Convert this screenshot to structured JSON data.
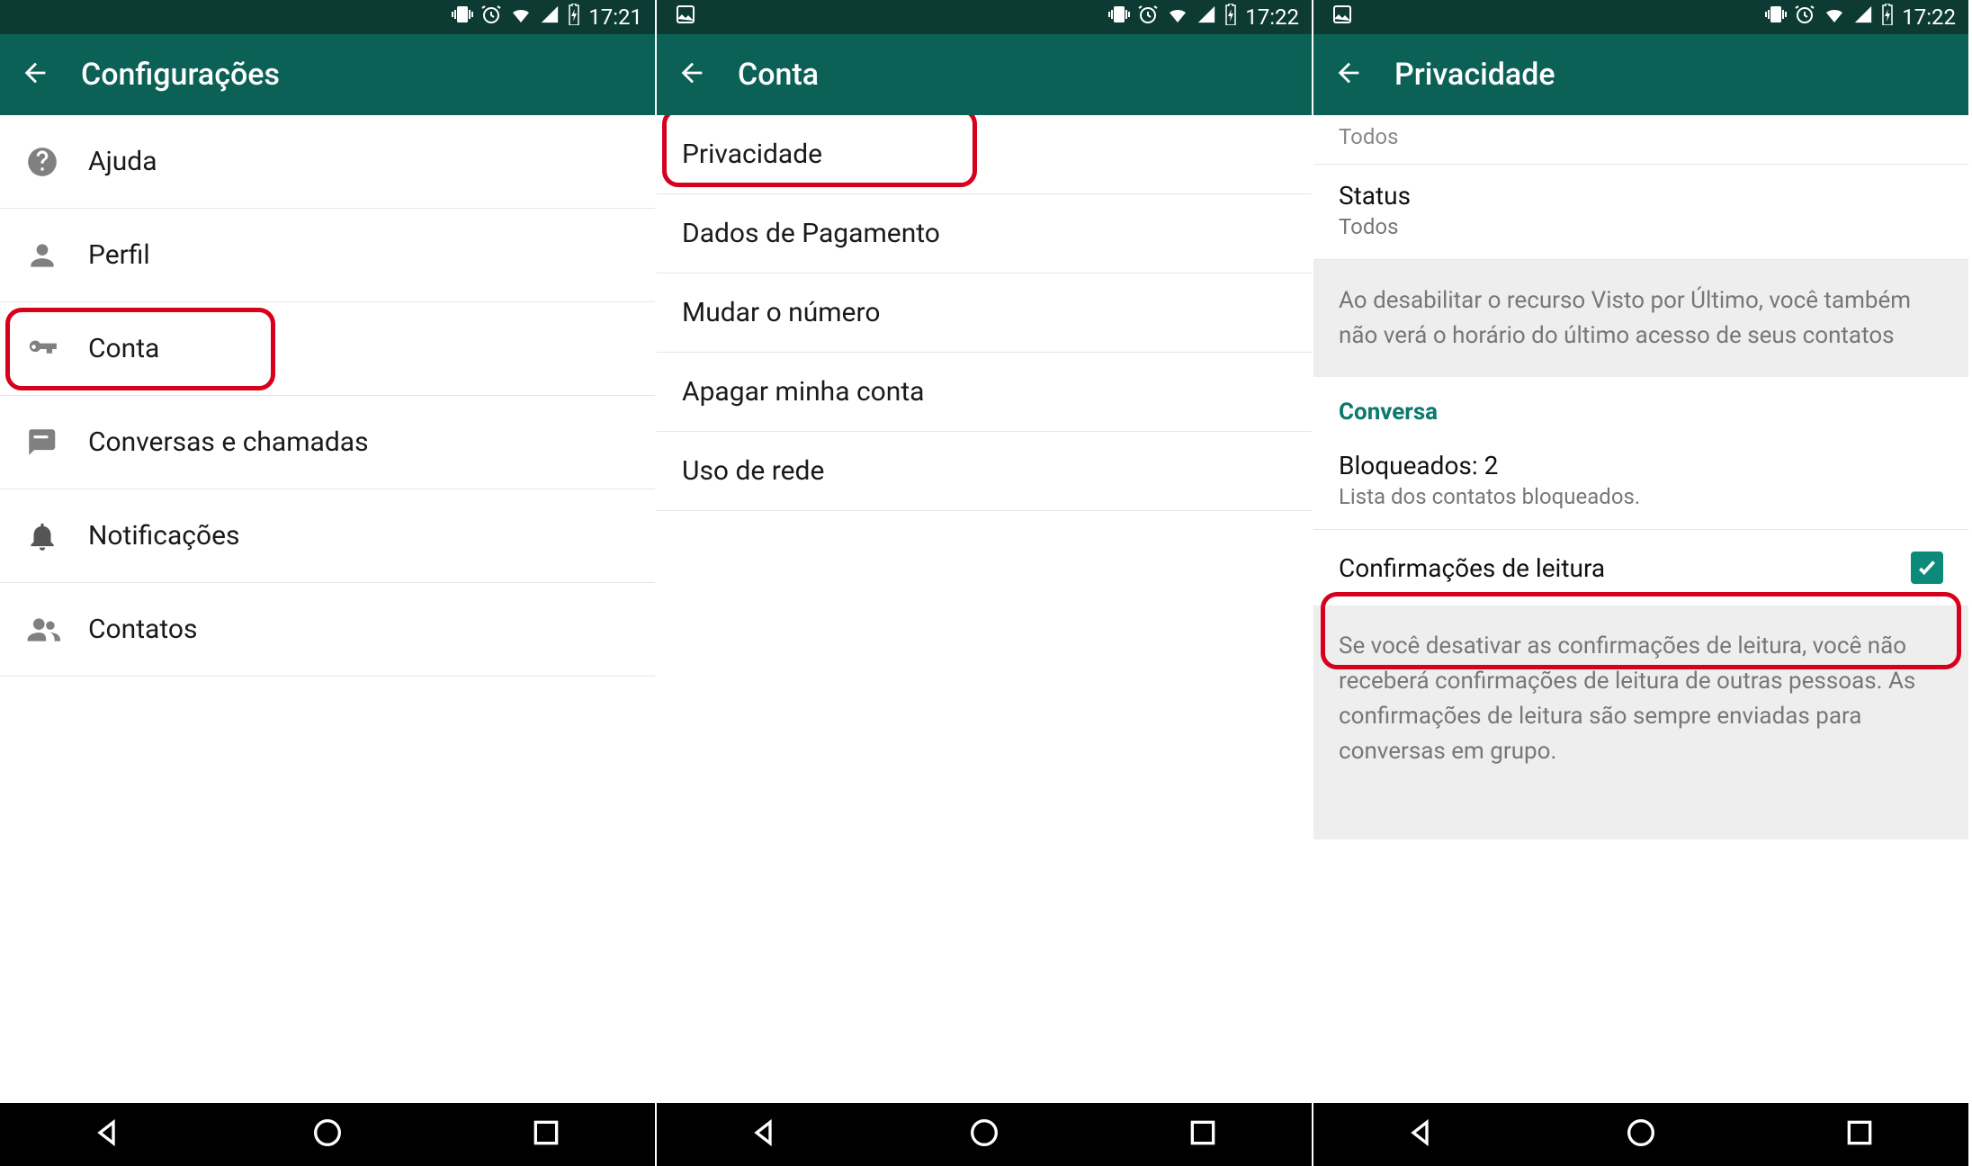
{
  "status": {
    "time1": "17:21",
    "time2": "17:22",
    "time3": "17:22"
  },
  "screen1": {
    "title": "Configurações",
    "items": [
      {
        "label": "Ajuda"
      },
      {
        "label": "Perfil"
      },
      {
        "label": "Conta"
      },
      {
        "label": "Conversas e chamadas"
      },
      {
        "label": "Notificações"
      },
      {
        "label": "Contatos"
      }
    ]
  },
  "screen2": {
    "title": "Conta",
    "items": [
      {
        "label": "Privacidade"
      },
      {
        "label": "Dados de Pagamento"
      },
      {
        "label": "Mudar o número"
      },
      {
        "label": "Apagar minha conta"
      },
      {
        "label": "Uso de rede"
      }
    ]
  },
  "screen3": {
    "title": "Privacidade",
    "todos_cut": "Todos",
    "status_label": "Status",
    "status_value": "Todos",
    "note1": "Ao desabilitar o recurso Visto por Último, você também não verá o horário do último acesso de seus contatos",
    "section": "Conversa",
    "blocked_label": "Bloqueados: 2",
    "blocked_sub": "Lista dos contatos bloqueados.",
    "read_label": "Confirmações de leitura",
    "note2": "Se você desativar as confirmações de leitura, você não receberá confirmações de leitura de outras pessoas. As confirmações de leitura são sempre enviadas para conversas em grupo."
  }
}
